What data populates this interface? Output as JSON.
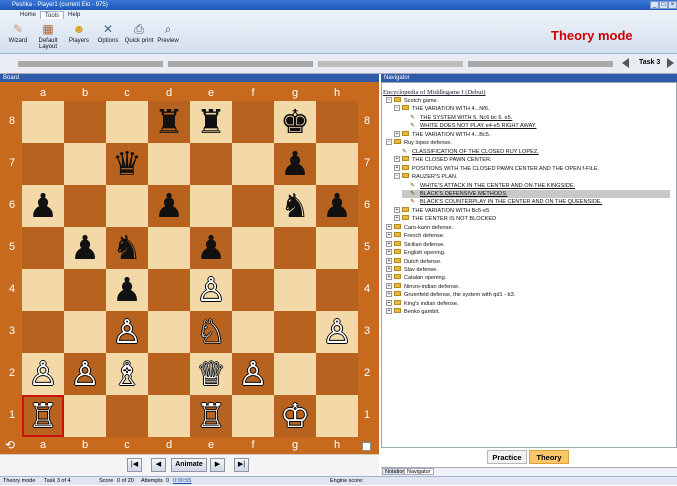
{
  "window": {
    "title": "Peshka - Player1 (current Elo - 975)",
    "min": "_",
    "max": "□",
    "close": "×"
  },
  "ribbon": {
    "tabs": [
      "Home",
      "Tools",
      "Help"
    ],
    "buttons": [
      "Wizard",
      "Default Layout",
      "Players",
      "Options",
      "Quick print",
      "Preview"
    ],
    "mode": "Theory mode"
  },
  "task": {
    "label": "Task 3"
  },
  "board_panel": {
    "title": "Board"
  },
  "board": {
    "files": [
      "a",
      "b",
      "c",
      "d",
      "e",
      "f",
      "g",
      "h"
    ],
    "ranks": [
      "8",
      "7",
      "6",
      "5",
      "4",
      "3",
      "2",
      "1"
    ],
    "pieces": [
      {
        "sq": "d8",
        "p": "♜",
        "c": "b"
      },
      {
        "sq": "e8",
        "p": "♜",
        "c": "b"
      },
      {
        "sq": "g8",
        "p": "♚",
        "c": "b"
      },
      {
        "sq": "c7",
        "p": "♛",
        "c": "b"
      },
      {
        "sq": "g7",
        "p": "♟",
        "c": "b"
      },
      {
        "sq": "a6",
        "p": "♟",
        "c": "b"
      },
      {
        "sq": "d6",
        "p": "♟",
        "c": "b"
      },
      {
        "sq": "g6",
        "p": "♞",
        "c": "b"
      },
      {
        "sq": "h6",
        "p": "♟",
        "c": "b"
      },
      {
        "sq": "b5",
        "p": "♟",
        "c": "b"
      },
      {
        "sq": "c5",
        "p": "♞",
        "c": "b"
      },
      {
        "sq": "e5",
        "p": "♟",
        "c": "b"
      },
      {
        "sq": "c4",
        "p": "♟",
        "c": "b"
      },
      {
        "sq": "e4",
        "p": "♙",
        "c": "w"
      },
      {
        "sq": "c3",
        "p": "♙",
        "c": "w"
      },
      {
        "sq": "e3",
        "p": "♘",
        "c": "w"
      },
      {
        "sq": "h3",
        "p": "♙",
        "c": "w"
      },
      {
        "sq": "a2",
        "p": "♙",
        "c": "w"
      },
      {
        "sq": "b2",
        "p": "♙",
        "c": "w"
      },
      {
        "sq": "c2",
        "p": "♗",
        "c": "w"
      },
      {
        "sq": "e2",
        "p": "♕",
        "c": "w"
      },
      {
        "sq": "f2",
        "p": "♙",
        "c": "w"
      },
      {
        "sq": "a1",
        "p": "♖",
        "c": "w"
      },
      {
        "sq": "e1",
        "p": "♖",
        "c": "w"
      },
      {
        "sq": "g1",
        "p": "♔",
        "c": "w"
      }
    ],
    "selected": "a1"
  },
  "playback": {
    "first": "|◀",
    "prev": "◀",
    "animate": "Animate",
    "next": "▶",
    "last": "▶|"
  },
  "navigator": {
    "title": "Navigator",
    "heading": "Encyclopedia of Middlegame I (Debut)",
    "items": [
      {
        "t": "Scotch game.",
        "lvl": 0,
        "k": "folder",
        "exp": "−"
      },
      {
        "t": "THE VARIATION WITH 4...Nf6.",
        "lvl": 1,
        "k": "folder",
        "exp": "−"
      },
      {
        "t": "THE SYSTEM WITH 5. Nc6 bc 6. e5.",
        "lvl": 2,
        "k": "page",
        "link": true
      },
      {
        "t": "WHITE DOES NOT PLAY e4-e5 RIGHT AWAY.",
        "lvl": 2,
        "k": "page",
        "link": true
      },
      {
        "t": "THE VARIATION WITH 4...Bc5.",
        "lvl": 1,
        "k": "folder",
        "exp": "+"
      },
      {
        "t": "Ruy lopez defense.",
        "lvl": 0,
        "k": "folder",
        "exp": "−"
      },
      {
        "t": "CLASSIFICATION OF THE CLOSED RUY LOPEZ.",
        "lvl": 1,
        "k": "page",
        "link": true
      },
      {
        "t": "THE CLOSED PAWN CENTER.",
        "lvl": 1,
        "k": "folder",
        "exp": "+"
      },
      {
        "t": "POSITIONS WITH THE CLOSED PAWN CENTER AND THE OPEN f-FILE.",
        "lvl": 1,
        "k": "folder",
        "exp": "+"
      },
      {
        "t": "RAUZER'S PLAN.",
        "lvl": 1,
        "k": "folder",
        "exp": "−"
      },
      {
        "t": "WHITE'S ATTACK IN THE CENTER AND ON THE KINGSIDE.",
        "lvl": 2,
        "k": "page",
        "link": true
      },
      {
        "t": "BLACK'S DEFENSIVE METHODS.",
        "lvl": 2,
        "k": "page",
        "link": true,
        "hl": true
      },
      {
        "t": "BLACK'S COUNTERPLAY IN THE CENTER AND ON THE QUEENSIDE.",
        "lvl": 2,
        "k": "page",
        "link": true
      },
      {
        "t": "THE VARIATION WITH Bc5-e5",
        "lvl": 1,
        "k": "folder",
        "exp": "+"
      },
      {
        "t": "THE CENTER IS NOT BLOCKED",
        "lvl": 1,
        "k": "folder",
        "exp": "+"
      },
      {
        "t": "Caro-kann defense.",
        "lvl": 0,
        "k": "folder",
        "exp": "+"
      },
      {
        "t": "French defense.",
        "lvl": 0,
        "k": "folder",
        "exp": "+"
      },
      {
        "t": "Sicilian defense.",
        "lvl": 0,
        "k": "folder",
        "exp": "+"
      },
      {
        "t": "English opening.",
        "lvl": 0,
        "k": "folder",
        "exp": "+"
      },
      {
        "t": "Dutch defense.",
        "lvl": 0,
        "k": "folder",
        "exp": "+"
      },
      {
        "t": "Slav defense.",
        "lvl": 0,
        "k": "folder",
        "exp": "+"
      },
      {
        "t": "Catalan opening.",
        "lvl": 0,
        "k": "folder",
        "exp": "+"
      },
      {
        "t": "Nimzo-indian defense.",
        "lvl": 0,
        "k": "folder",
        "exp": "+"
      },
      {
        "t": "Gruenfeld defense, the system with qd1 - b3.",
        "lvl": 0,
        "k": "folder",
        "exp": "+"
      },
      {
        "t": "King's indian defense.",
        "lvl": 0,
        "k": "folder",
        "exp": "+"
      },
      {
        "t": "Benko gambit.",
        "lvl": 0,
        "k": "folder",
        "exp": "+"
      }
    ],
    "practice": "Practice",
    "theory": "Theory",
    "tabs": [
      "Notation",
      "Navigator"
    ]
  },
  "status": {
    "mode": "Theory mode",
    "task": "Task 3 of 4",
    "score_label": "Score",
    "score": "0 of 20",
    "attempts_label": "Attempts",
    "attempts": "0",
    "time": "0:00:55",
    "engine": "Engine score:"
  }
}
